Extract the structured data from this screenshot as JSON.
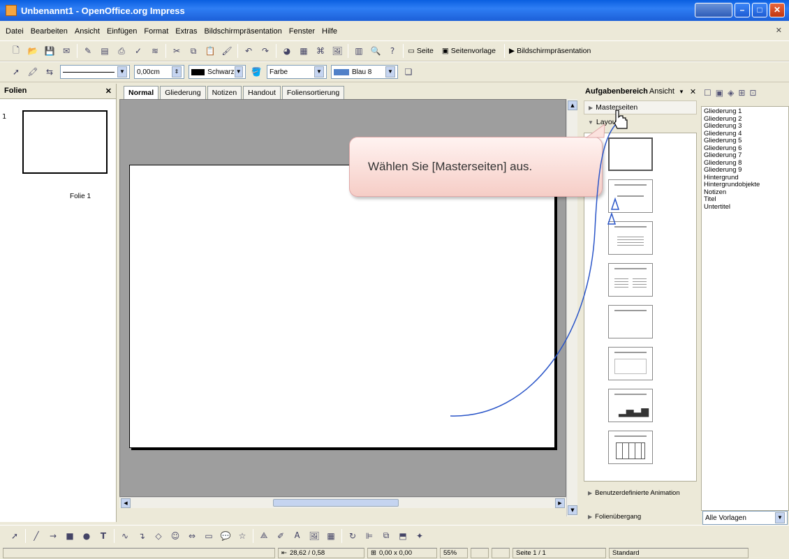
{
  "window": {
    "title": "Unbenannt1 - OpenOffice.org Impress"
  },
  "menu": [
    "Datei",
    "Bearbeiten",
    "Ansicht",
    "Einfügen",
    "Format",
    "Extras",
    "Bildschirmpräsentation",
    "Fenster",
    "Hilfe"
  ],
  "toolbar": {
    "seite": "Seite",
    "seitenvorlage": "Seitenvorlage",
    "praesentation": "Bildschirmpräsentation"
  },
  "format_toolbar": {
    "line_width": "0,00cm",
    "line_color": "Schwarz",
    "fill_type": "Farbe",
    "fill_color": "Blau 8"
  },
  "left_panel": {
    "title": "Folien",
    "slide_number": "1",
    "slide_label": "Folie 1"
  },
  "view_tabs": [
    "Normal",
    "Gliederung",
    "Notizen",
    "Handout",
    "Foliensortierung"
  ],
  "task_pane": {
    "title": "Aufgabenbereich",
    "view_menu": "Ansicht",
    "sections": {
      "master": "Masterseiten",
      "layouts": "Layouts",
      "custom_animation": "Benutzerdefinierte Animation",
      "transition": "Folienübergang"
    }
  },
  "styles": {
    "items": [
      "Gliederung 1",
      "Gliederung 2",
      "Gliederung 3",
      "Gliederung 4",
      "Gliederung 5",
      "Gliederung 6",
      "Gliederung 7",
      "Gliederung 8",
      "Gliederung 9",
      "Hintergrund",
      "Hintergrundobjekte",
      "Notizen",
      "Titel",
      "Untertitel"
    ],
    "filter": "Alle Vorlagen"
  },
  "statusbar": {
    "position": "28,62 / 0,58",
    "size": "0,00 x 0,00",
    "zoom": "55%",
    "page": "Seite 1 / 1",
    "layout": "Standard"
  },
  "callout": {
    "text": "Wählen Sie [Masterseiten] aus."
  }
}
